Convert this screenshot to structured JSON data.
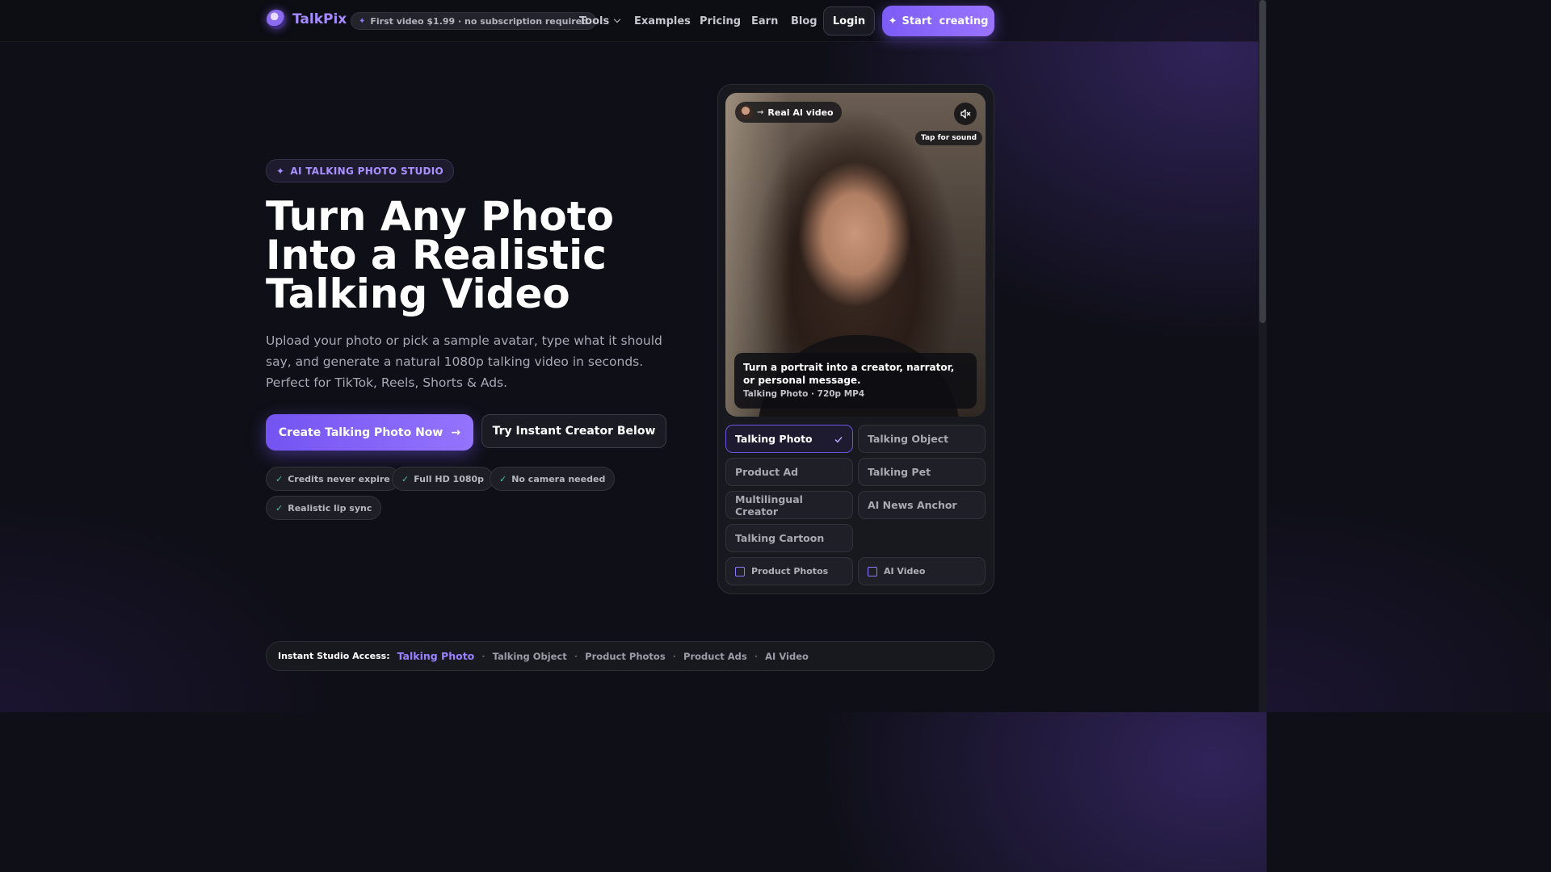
{
  "header": {
    "logo_text": "TalkPix",
    "promo": "First video $1.99 · no subscription required",
    "nav": [
      {
        "label": "Tools",
        "dropdown": true
      },
      {
        "label": "Examples"
      },
      {
        "label": "Pricing"
      },
      {
        "label": "Earn"
      },
      {
        "label": "Blog"
      }
    ],
    "login": "Login",
    "start": "Start  creating"
  },
  "hero": {
    "badge": "AI TALKING PHOTO STUDIO",
    "headline": [
      "Turn Any Photo",
      "Into a Realistic",
      "Talking Video"
    ],
    "subtext": "Upload your photo or pick a sample avatar, type what it should say, and generate a natural 1080p talking video in seconds. Perfect for TikTok, Reels, Shorts & Ads.",
    "cta_primary": "Create Talking Photo Now",
    "cta_secondary": "Try Instant Creator Below",
    "features": [
      "Credits never expire",
      "Full HD 1080p",
      "No camera needed",
      "Realistic lip sync"
    ]
  },
  "preview": {
    "chip": "Real AI video",
    "tap": "Tap for sound",
    "caption_title": "Turn a portrait into a creator, narrator, or personal message.",
    "caption_meta": "Talking Photo · 720p MP4",
    "options": [
      "Talking Photo",
      "Talking Object",
      "Product Ad",
      "Talking Pet",
      "Multilingual Creator",
      "AI News Anchor",
      "Talking Cartoon"
    ],
    "selected": "Talking Photo",
    "extras": [
      "Product Photos",
      "AI Video"
    ]
  },
  "access": {
    "label": "Instant Studio Access:",
    "items": [
      "Talking Photo",
      "Talking Object",
      "Product Photos",
      "Product Ads",
      "AI Video"
    ]
  },
  "colors": {
    "accent": "#7b5cf5",
    "background": "#0f0f17",
    "check": "#49c4a2"
  }
}
